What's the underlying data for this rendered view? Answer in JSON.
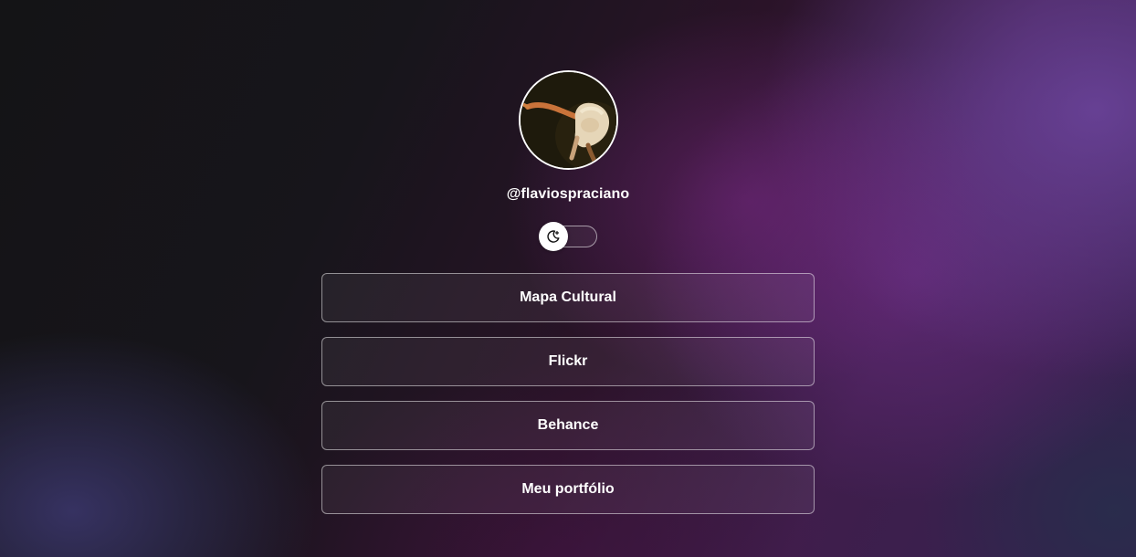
{
  "profile": {
    "handle": "@flaviospraciano"
  },
  "theme_toggle": {
    "icon": "moon-star-icon",
    "state": "dark"
  },
  "links": [
    {
      "label": "Mapa Cultural"
    },
    {
      "label": "Flickr"
    },
    {
      "label": "Behance"
    },
    {
      "label": "Meu portfólio"
    }
  ],
  "colors": {
    "text": "#ffffff",
    "button_border": "#8a7f95",
    "accent_purple": "#6a3a8a"
  }
}
